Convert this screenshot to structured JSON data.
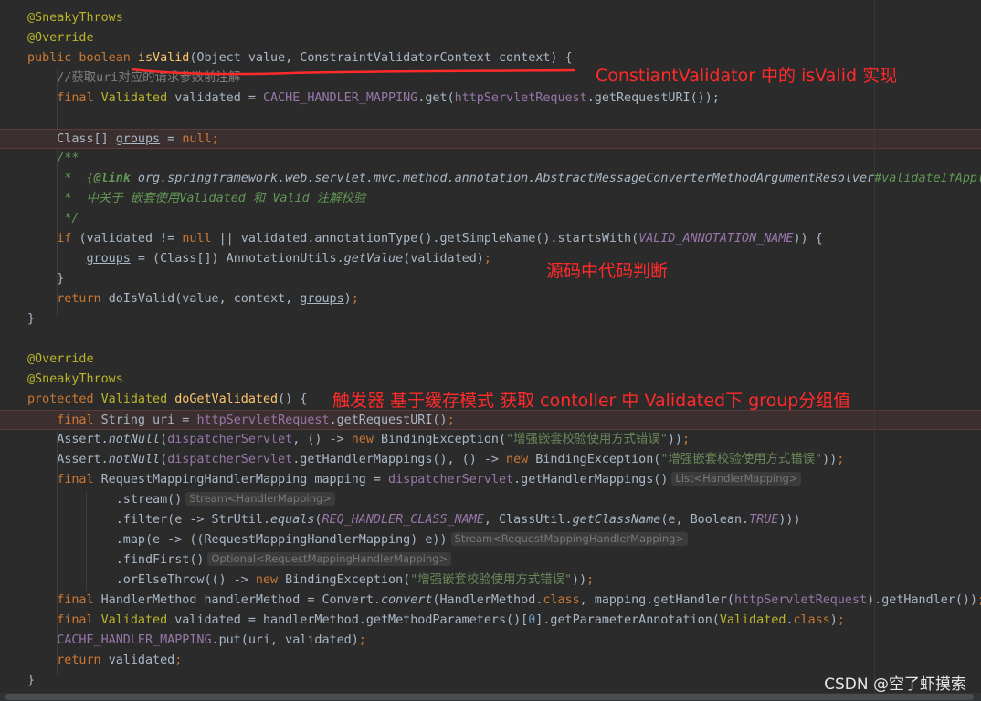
{
  "code_lines": [
    {
      "line": 1,
      "tokens": [
        {
          "t": "@SneakyThrows",
          "c": "anno"
        }
      ]
    },
    {
      "line": 2,
      "tokens": [
        {
          "t": "@Override",
          "c": "anno"
        }
      ]
    },
    {
      "line": 3,
      "tokens": [
        {
          "t": "public boolean ",
          "c": "kw"
        },
        {
          "t": "isValid",
          "c": "method"
        },
        {
          "t": "(Object value, ConstraintValidatorContext context) {",
          "c": "plain"
        }
      ]
    },
    {
      "line": 4,
      "tokens": [
        {
          "t": "    //获取uri对应的请求参数前注解",
          "c": "cmt"
        }
      ]
    },
    {
      "line": 5,
      "tokens": [
        {
          "t": "    final ",
          "c": "kw"
        },
        {
          "t": "Validated ",
          "c": "anno"
        },
        {
          "t": "validated = ",
          "c": "plain"
        },
        {
          "t": "CACHE_HANDLER_MAPPING",
          "c": "field"
        },
        {
          "t": ".get(",
          "c": "plain"
        },
        {
          "t": "httpServletRequest",
          "c": "field"
        },
        {
          "t": ".getRequestURI());",
          "c": "plain"
        }
      ]
    },
    {
      "line": 6,
      "tokens": []
    },
    {
      "line": 7,
      "err": true,
      "tokens": [
        {
          "t": "    Class[] ",
          "c": "plain"
        },
        {
          "t": "groups",
          "c": "plain under"
        },
        {
          "t": " = ",
          "c": "plain"
        },
        {
          "t": "null",
          "c": "kw"
        },
        {
          "t": ";",
          "c": "kw"
        }
      ]
    },
    {
      "line": 8,
      "tokens": [
        {
          "t": "    /**",
          "c": "doc"
        }
      ]
    },
    {
      "line": 9,
      "tokens": [
        {
          "t": "     *  {",
          "c": "doc"
        },
        {
          "t": "@link",
          "c": "doctag"
        },
        {
          "t": " org.springframework.web.servlet.mvc.method.annotation.AbstractMessageConverterMethodArgumentResolver",
          "c": "plain italic"
        },
        {
          "t": "#validateIfAppli",
          "c": "doc"
        }
      ]
    },
    {
      "line": 10,
      "tokens": [
        {
          "t": "     *  中关于 嵌套使用Validated 和 Valid 注解校验",
          "c": "doc"
        }
      ]
    },
    {
      "line": 11,
      "tokens": [
        {
          "t": "     */",
          "c": "doc"
        }
      ]
    },
    {
      "line": 12,
      "tokens": [
        {
          "t": "    if ",
          "c": "kw"
        },
        {
          "t": "(validated != ",
          "c": "plain"
        },
        {
          "t": "null ",
          "c": "kw"
        },
        {
          "t": "|| validated.annotationType().getSimpleName().startsWith(",
          "c": "plain"
        },
        {
          "t": "VALID_ANNOTATION_NAME",
          "c": "stat"
        },
        {
          "t": ")) {",
          "c": "plain"
        }
      ]
    },
    {
      "line": 13,
      "tokens": [
        {
          "t": "        ",
          "c": "plain"
        },
        {
          "t": "groups",
          "c": "plain under"
        },
        {
          "t": " = (Class[]) AnnotationUtils.",
          "c": "plain"
        },
        {
          "t": "getValue",
          "c": "plain italic"
        },
        {
          "t": "(validated)",
          "c": "plain"
        },
        {
          "t": ";",
          "c": "kw"
        }
      ]
    },
    {
      "line": 14,
      "tokens": [
        {
          "t": "    }",
          "c": "plain"
        }
      ]
    },
    {
      "line": 15,
      "tokens": [
        {
          "t": "    return ",
          "c": "kw"
        },
        {
          "t": "doIsValid(value, context, ",
          "c": "plain"
        },
        {
          "t": "groups",
          "c": "plain under"
        },
        {
          "t": ")",
          "c": "plain"
        },
        {
          "t": ";",
          "c": "kw"
        }
      ]
    },
    {
      "line": 16,
      "tokens": [
        {
          "t": "}",
          "c": "plain"
        }
      ]
    },
    {
      "line": 17,
      "tokens": []
    },
    {
      "line": 18,
      "tokens": [
        {
          "t": "@Override",
          "c": "anno"
        }
      ]
    },
    {
      "line": 19,
      "tokens": [
        {
          "t": "@SneakyThrows",
          "c": "anno"
        }
      ]
    },
    {
      "line": 20,
      "tokens": [
        {
          "t": "protected ",
          "c": "kw"
        },
        {
          "t": "Validated ",
          "c": "anno"
        },
        {
          "t": "doGetValidated",
          "c": "method"
        },
        {
          "t": "() {",
          "c": "plain"
        }
      ]
    },
    {
      "line": 21,
      "err": true,
      "tokens": [
        {
          "t": "    final ",
          "c": "kw"
        },
        {
          "t": "String uri = ",
          "c": "plain"
        },
        {
          "t": "httpServletRequest",
          "c": "field"
        },
        {
          "t": ".getRequestURI()",
          "c": "plain"
        },
        {
          "t": ";",
          "c": "kw"
        }
      ]
    },
    {
      "line": 22,
      "tokens": [
        {
          "t": "    Assert.",
          "c": "plain"
        },
        {
          "t": "notNull",
          "c": "plain italic"
        },
        {
          "t": "(",
          "c": "plain"
        },
        {
          "t": "dispatcherServlet",
          "c": "field"
        },
        {
          "t": ", () -> ",
          "c": "plain"
        },
        {
          "t": "new ",
          "c": "kw"
        },
        {
          "t": "BindingException(",
          "c": "plain"
        },
        {
          "t": "\"增强嵌套校验使用方式错误\"",
          "c": "str"
        },
        {
          "t": "))",
          "c": "plain"
        },
        {
          "t": ";",
          "c": "kw"
        }
      ]
    },
    {
      "line": 23,
      "tokens": [
        {
          "t": "    Assert.",
          "c": "plain"
        },
        {
          "t": "notNull",
          "c": "plain italic"
        },
        {
          "t": "(",
          "c": "plain"
        },
        {
          "t": "dispatcherServlet",
          "c": "field"
        },
        {
          "t": ".getHandlerMappings(), () -> ",
          "c": "plain"
        },
        {
          "t": "new ",
          "c": "kw"
        },
        {
          "t": "BindingException(",
          "c": "plain"
        },
        {
          "t": "\"增强嵌套校验使用方式错误\"",
          "c": "str"
        },
        {
          "t": "))",
          "c": "plain"
        },
        {
          "t": ";",
          "c": "kw"
        }
      ]
    },
    {
      "line": 24,
      "tokens": [
        {
          "t": "    final ",
          "c": "kw"
        },
        {
          "t": "RequestMappingHandlerMapping mapping = ",
          "c": "plain"
        },
        {
          "t": "dispatcherServlet",
          "c": "field"
        },
        {
          "t": ".getHandlerMappings()",
          "c": "plain"
        }
      ],
      "hint": "List<HandlerMapping>"
    },
    {
      "line": 25,
      "tokens": [
        {
          "t": "            .stream()",
          "c": "plain"
        }
      ],
      "hint": "Stream<HandlerMapping>"
    },
    {
      "line": 26,
      "tokens": [
        {
          "t": "            .filter(e -> StrUtil.",
          "c": "plain"
        },
        {
          "t": "equals",
          "c": "plain italic"
        },
        {
          "t": "(",
          "c": "plain"
        },
        {
          "t": "REQ_HANDLER_CLASS_NAME",
          "c": "stat"
        },
        {
          "t": ", ClassUtil.",
          "c": "plain"
        },
        {
          "t": "getClassName",
          "c": "plain italic"
        },
        {
          "t": "(e, Boolean.",
          "c": "plain"
        },
        {
          "t": "TRUE",
          "c": "stat"
        },
        {
          "t": ")))",
          "c": "plain"
        }
      ]
    },
    {
      "line": 27,
      "tokens": [
        {
          "t": "            .map(e -> ((RequestMappingHandlerMapping) e))",
          "c": "plain"
        }
      ],
      "hint": "Stream<RequestMappingHandlerMapping>"
    },
    {
      "line": 28,
      "tokens": [
        {
          "t": "            .findFirst()",
          "c": "plain"
        }
      ],
      "hint": "Optional<RequestMappingHandlerMapping>"
    },
    {
      "line": 29,
      "tokens": [
        {
          "t": "            .orElseThrow(() -> ",
          "c": "plain"
        },
        {
          "t": "new ",
          "c": "kw"
        },
        {
          "t": "BindingException(",
          "c": "plain"
        },
        {
          "t": "\"增强嵌套校验使用方式错误\"",
          "c": "str"
        },
        {
          "t": "))",
          "c": "plain"
        },
        {
          "t": ";",
          "c": "kw"
        }
      ]
    },
    {
      "line": 30,
      "tokens": [
        {
          "t": "    final ",
          "c": "kw"
        },
        {
          "t": "HandlerMethod handlerMethod = Convert.",
          "c": "plain"
        },
        {
          "t": "convert",
          "c": "plain italic"
        },
        {
          "t": "(HandlerMethod.",
          "c": "plain"
        },
        {
          "t": "class",
          "c": "kw"
        },
        {
          "t": ", mapping.getHandler(",
          "c": "plain"
        },
        {
          "t": "httpServletRequest",
          "c": "field"
        },
        {
          "t": ").getHandler())",
          "c": "plain"
        },
        {
          "t": ";",
          "c": "kw"
        }
      ]
    },
    {
      "line": 31,
      "tokens": [
        {
          "t": "    final ",
          "c": "kw"
        },
        {
          "t": "Validated ",
          "c": "anno"
        },
        {
          "t": "validated = handlerMethod.getMethodParameters()[",
          "c": "plain"
        },
        {
          "t": "0",
          "c": "num"
        },
        {
          "t": "].getParameterAnnotation(",
          "c": "plain"
        },
        {
          "t": "Validated",
          "c": "anno"
        },
        {
          "t": ".",
          "c": "plain"
        },
        {
          "t": "class",
          "c": "kw"
        },
        {
          "t": ")",
          "c": "plain"
        },
        {
          "t": ";",
          "c": "kw"
        }
      ]
    },
    {
      "line": 32,
      "tokens": [
        {
          "t": "    CACHE_HANDLER_MAPPING",
          "c": "field"
        },
        {
          "t": ".put(uri, validated)",
          "c": "plain"
        },
        {
          "t": ";",
          "c": "kw"
        }
      ]
    },
    {
      "line": 33,
      "tokens": [
        {
          "t": "    return ",
          "c": "kw"
        },
        {
          "t": "validated",
          "c": "plain"
        },
        {
          "t": ";",
          "c": "kw"
        }
      ]
    },
    {
      "line": 34,
      "tokens": [
        {
          "t": "}",
          "c": "plain"
        }
      ]
    }
  ],
  "annotations": {
    "note1": "ConstiantValidator 中的 isValid 实现",
    "note2": "源码中代码判断",
    "note3": "触发器 基于缓存模式 获取 contoller 中 Validated下 group分组值"
  },
  "watermark": "CSDN @空了虾摸索",
  "colors": {
    "background": "#2b2b2b",
    "keyword": "#cc7832",
    "annotation": "#bbb529",
    "method": "#ffc66d",
    "field": "#9876aa",
    "string": "#6a8759",
    "comment": "#808080",
    "doc": "#629755",
    "red_note": "#ff2a2a"
  }
}
